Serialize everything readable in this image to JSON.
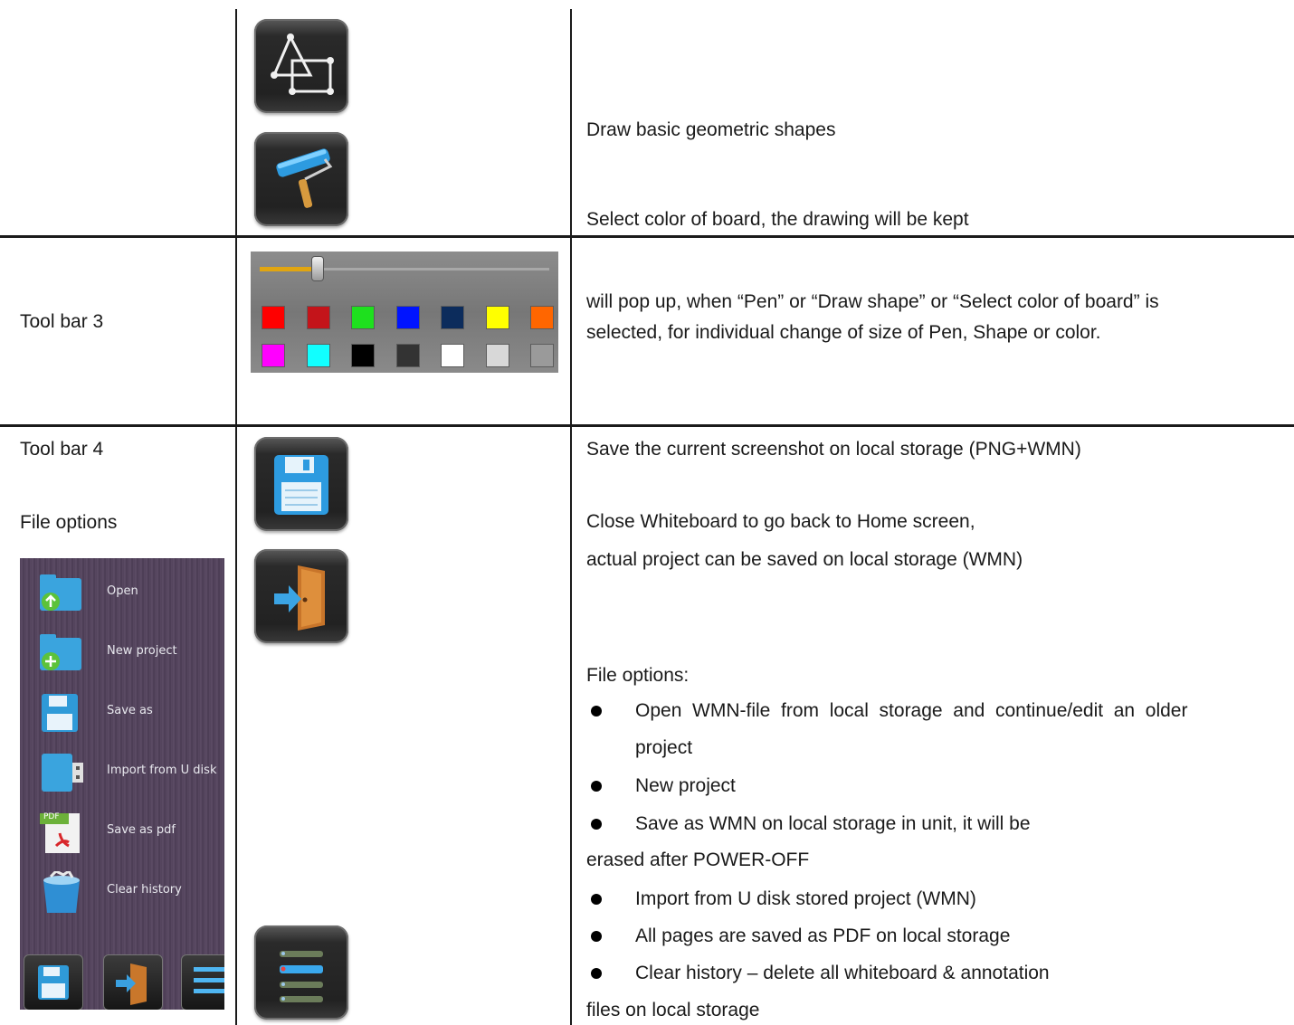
{
  "row1": {
    "shapes_desc": "Draw basic geometric shapes",
    "board_color_desc": "Select color of board, the drawing will be kept"
  },
  "row2": {
    "label": "Tool bar 3",
    "desc_line1": "will pop up, when “Pen” or “Draw shape” or “Select color of board” is",
    "desc_line2": "selected, for individual change of size of Pen, Shape or color.",
    "palette_colors": [
      "#ff0000",
      "#c4141a",
      "#1ee01e",
      "#0014ff",
      "#0c2c5c",
      "#ffff00",
      "#ff6600",
      "#ff00ff",
      "#11ffff",
      "#000000",
      "#333333",
      "#ffffff",
      "#d8d8d8",
      "#9a9a9a"
    ],
    "size_level": 0.18
  },
  "row3": {
    "label1": "Tool bar 4",
    "label2": "File options",
    "save_desc": "Save the current screenshot on local storage (PNG+WMN)",
    "close_desc1": "Close Whiteboard to go back to Home screen,",
    "close_desc2": "actual project can be saved on local storage (WMN)",
    "file_options_heading": "File options:",
    "bullets": [
      {
        "line1": "Open  WMN-file  from  local  storage  and  continue/edit  an  older",
        "line2": "project"
      },
      {
        "line1": "New project",
        "line2": ""
      },
      {
        "line1": "Save as WMN on local storage in unit, it will be",
        "line2": "erased after POWER-OFF"
      },
      {
        "line1": "Import from U disk stored project (WMN)",
        "line2": ""
      },
      {
        "line1": "All pages are saved as PDF on local storage",
        "line2": ""
      },
      {
        "line1": "Clear history – delete all whiteboard & annotation",
        "line2": "files on local storage"
      }
    ],
    "file_menu": [
      "Open",
      "New project",
      "Save as",
      "Import from U disk",
      "Save as pdf",
      "Clear history"
    ],
    "pdf_badge": "PDF"
  }
}
